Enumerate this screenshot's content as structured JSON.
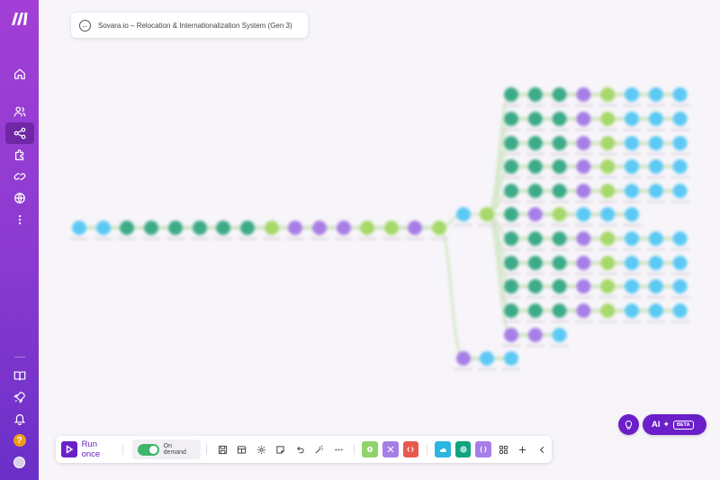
{
  "sidebar": {
    "items": [
      {
        "icon": "home-icon"
      },
      {
        "icon": "users-icon"
      },
      {
        "icon": "scenarios-icon",
        "active": true
      },
      {
        "icon": "puzzle-icon"
      },
      {
        "icon": "link-icon"
      },
      {
        "icon": "globe-icon"
      },
      {
        "icon": "more-vertical-icon"
      }
    ],
    "bottom": [
      {
        "icon": "book-icon"
      },
      {
        "icon": "rocket-icon"
      },
      {
        "icon": "bell-icon"
      },
      {
        "icon": "help-icon",
        "label": "?"
      },
      {
        "icon": "avatar"
      }
    ]
  },
  "header": {
    "title": "Sovara.io – Relocation & Internationalization System (Gen 3)"
  },
  "toolbar": {
    "run_label": "Run once",
    "schedule_label": "On demand",
    "schedule_enabled": true
  },
  "ai_button": {
    "label": "AI",
    "badge": "BETA"
  },
  "colors": {
    "brand": "#6b1fc9",
    "sidebar_top": "#a23fd6",
    "teal": "#3daa88",
    "cyan": "#5cc9f5",
    "purple": "#a67ee6",
    "lime": "#a6d86b"
  }
}
